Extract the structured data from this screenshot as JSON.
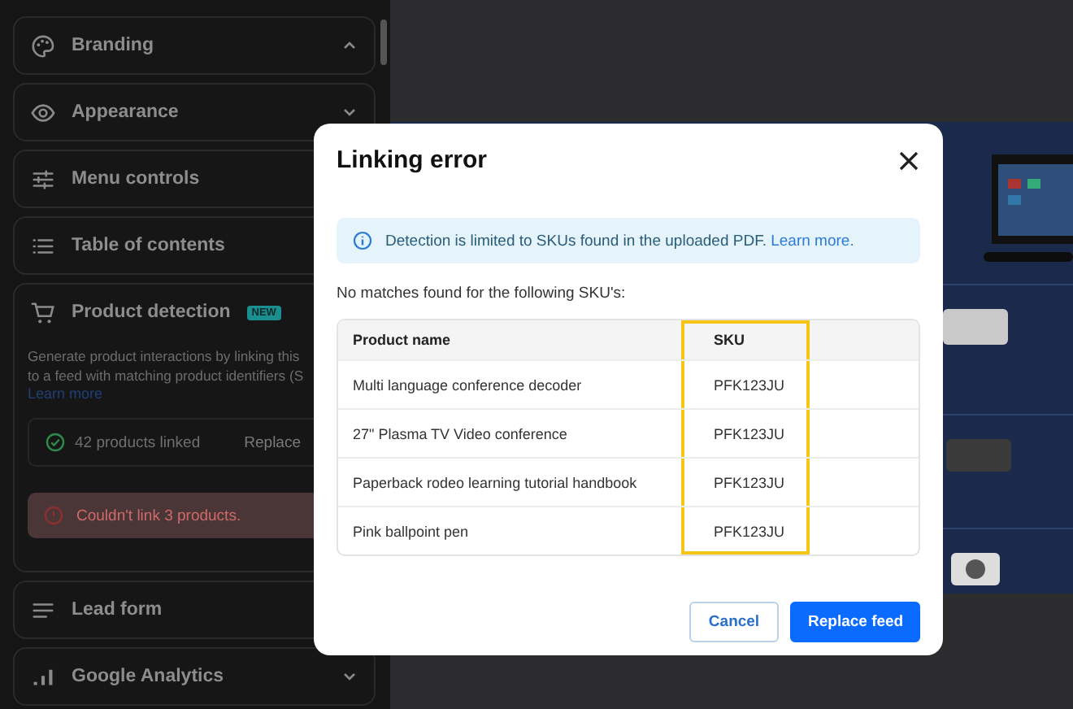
{
  "sidebar": {
    "sections": [
      {
        "kind": "plain",
        "label": "Branding",
        "expanded": true
      },
      {
        "kind": "plain",
        "label": "Appearance",
        "expanded": false
      },
      {
        "kind": "plain",
        "label": "Menu controls"
      },
      {
        "kind": "plain",
        "label": "Table of contents"
      },
      {
        "kind": "detail",
        "label": "Product detection",
        "badge": "NEW",
        "description_lines": [
          "Generate product interactions by linking this",
          "to a feed with matching product identifiers (S"
        ],
        "link": "Learn more",
        "linked": {
          "text": "42 products linked",
          "action": "Replace"
        },
        "error": {
          "text": "Couldn't link 3 products."
        }
      },
      {
        "kind": "plain",
        "label": "Lead form"
      },
      {
        "kind": "plain",
        "label": "Google Analytics",
        "expanded": false
      }
    ]
  },
  "dialog": {
    "title": "Linking error",
    "notice": {
      "text": "Detection is limited to SKUs found in the uploaded PDF.",
      "link": "Learn more."
    },
    "intro": "No matches found for the following SKU's:",
    "table": {
      "columns": [
        {
          "label": "Product name",
          "highlighted": false
        },
        {
          "label": "SKU",
          "highlighted": true
        }
      ],
      "rows": [
        [
          "Multi language conference decoder",
          "PFK123JU"
        ],
        [
          "27\" Plasma TV Video conference",
          "PFK123JU"
        ],
        [
          "Paperback rodeo learning tutorial handbook",
          "PFK123JU"
        ],
        [
          "Pink ballpoint pen",
          "PFK123JU"
        ]
      ]
    },
    "buttons": [
      {
        "label": "Cancel",
        "kind": "secondary"
      },
      {
        "label": "Replace feed",
        "kind": "primary"
      }
    ]
  }
}
